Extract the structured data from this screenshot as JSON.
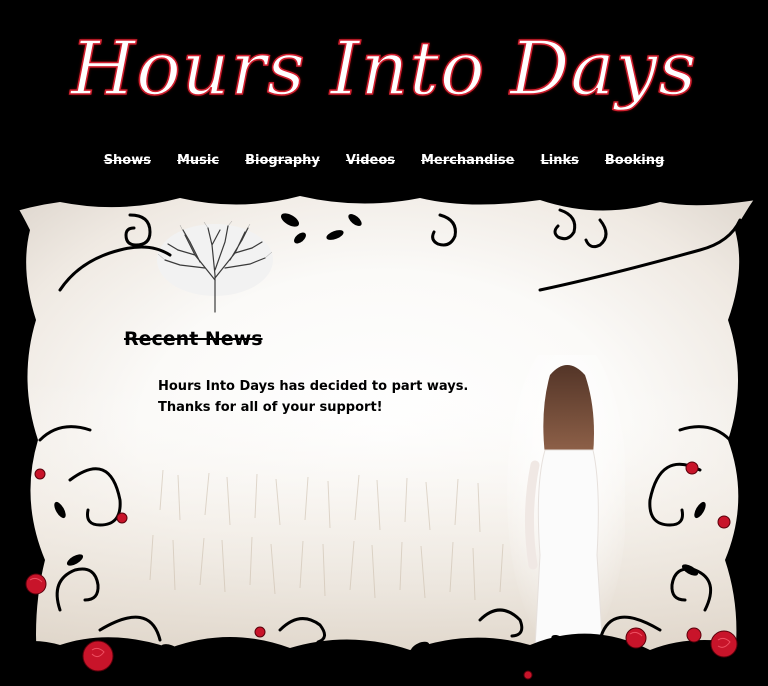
{
  "header": {
    "title": "Hours Into Days"
  },
  "nav": {
    "items": [
      {
        "label": "Shows"
      },
      {
        "label": "Music"
      },
      {
        "label": "Biography"
      },
      {
        "label": "Videos"
      },
      {
        "label": "Merchandise"
      },
      {
        "label": "Links"
      },
      {
        "label": "Booking"
      }
    ]
  },
  "main": {
    "news_heading": "Recent News",
    "news_text": "Hours Into Days has decided to part ways. Thanks for all of your support!"
  },
  "colors": {
    "background": "#000000",
    "title_outline": "#d21f2f",
    "rose": "#c8142a",
    "text": "#000000",
    "nav_text": "#ffffff"
  }
}
